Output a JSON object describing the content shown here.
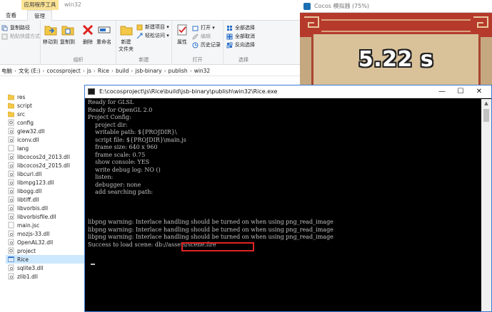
{
  "explorer": {
    "context_tab": "应用程序工具",
    "window_title": "win32",
    "menu_tabs": [
      "查看",
      "管理"
    ],
    "ribbon": {
      "copy_path": "复制路径",
      "paste_shortcut": "粘贴快捷方式",
      "move_to": "移动到",
      "copy_to": "复制到",
      "delete": "删除",
      "rename": "重命名",
      "new_folder_line1": "新建",
      "new_folder_line2": "文件夹",
      "new_item": "新建项目 ▾",
      "easy_access": "轻松访问 ▾",
      "properties": "属性",
      "open": "打开 ▾",
      "edit": "编辑",
      "history": "历史记录",
      "select_all": "全部选择",
      "select_none": "全部取消",
      "invert_selection": "反向选择",
      "group_organize": "组织",
      "group_new": "新建",
      "group_open": "打开",
      "group_select": "选择"
    },
    "breadcrumb": [
      "电脑",
      "文化 (E:)",
      "cocosproject",
      "js",
      "Rice",
      "build",
      "jsb-binary",
      "publish",
      "win32"
    ],
    "files": [
      {
        "name": "res",
        "kind": "folder"
      },
      {
        "name": "script",
        "kind": "folder"
      },
      {
        "name": "src",
        "kind": "folder"
      },
      {
        "name": "config",
        "kind": "gear"
      },
      {
        "name": "glew32.dll",
        "kind": "dll"
      },
      {
        "name": "iconv.dll",
        "kind": "dll"
      },
      {
        "name": "lang",
        "kind": "file"
      },
      {
        "name": "libcocos2d_2013.dll",
        "kind": "dll"
      },
      {
        "name": "libcocos2d_2015.dll",
        "kind": "dll"
      },
      {
        "name": "libcurl.dll",
        "kind": "dll"
      },
      {
        "name": "libmpg123.dll",
        "kind": "dll"
      },
      {
        "name": "libogg.dll",
        "kind": "dll"
      },
      {
        "name": "libtiff.dll",
        "kind": "dll"
      },
      {
        "name": "libvorbis.dll",
        "kind": "dll"
      },
      {
        "name": "libvorbisfile.dll",
        "kind": "dll"
      },
      {
        "name": "main.jsc",
        "kind": "file"
      },
      {
        "name": "mozjs-33.dll",
        "kind": "dll"
      },
      {
        "name": "OpenAL32.dll",
        "kind": "dll"
      },
      {
        "name": "project",
        "kind": "gear"
      },
      {
        "name": "Rice",
        "kind": "exe"
      },
      {
        "name": "sqlite3.dll",
        "kind": "dll"
      },
      {
        "name": "zlib1.dll",
        "kind": "dll"
      }
    ],
    "selected_file": "Rice"
  },
  "console": {
    "title": "E:\\cocosproject\\js\\Rice\\build\\jsb-binary\\publish\\win32\\Rice.exe",
    "lines": [
      "Ready for GLSL",
      "Ready for OpenGL 2.0",
      "Project Config:",
      "    project dir:",
      "    writable path: ${PROJDIR}\\",
      "    script file: ${PROJDIR}\\main.js",
      "    frame size: 640 x 960",
      "    frame scale: 0.75",
      "    show console: YES",
      "    write debug log: NO ()",
      "    listen:",
      "    debugger: none",
      "    add searching path:",
      "",
      "",
      "",
      "libpng warning: Interlace handling should be turned on when using png_read_image",
      "libpng warning: Interlace handling should be turned on when using png_read_image",
      "libpng warning: Interlace handling should be turned on when using png_read_image",
      "Success to load scene: db://assets/scene.fire"
    ],
    "highlighted_line": "show console: YES",
    "minimize": "—",
    "maximize": "☐",
    "close": "✕"
  },
  "simulator": {
    "title": "Cocos 模拟器 (75%)",
    "timer": "5.22 s",
    "colors": {
      "frame_red": "#b53a2c",
      "panel": "#d9c19a"
    }
  },
  "colors": {
    "console_bg": "#000000",
    "console_text": "#c0c0c0",
    "highlight": "#e02424",
    "selection": "#cce8ff",
    "context_tab": "#fbe395"
  }
}
